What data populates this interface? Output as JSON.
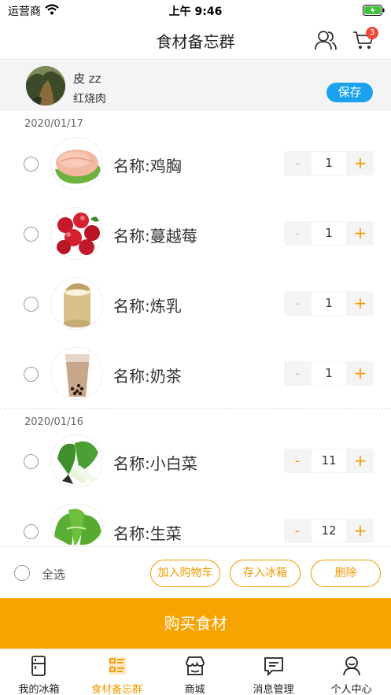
{
  "status_bar": {
    "carrier": "运营商",
    "time": "上午 9:46"
  },
  "nav": {
    "title": "食材备忘群",
    "cart_count": "3"
  },
  "user": {
    "name": "皮 zz",
    "dish": "红烧肉",
    "save_label": "保存"
  },
  "groups": [
    {
      "date": "2020/01/17",
      "items": [
        {
          "name": "名称:鸡胸",
          "qty": "1",
          "minus_enabled": false,
          "image": "chicken-breast"
        },
        {
          "name": "名称:蔓越莓",
          "qty": "1",
          "minus_enabled": false,
          "image": "cranberry"
        },
        {
          "name": "名称:炼乳",
          "qty": "1",
          "minus_enabled": false,
          "image": "condensed-milk-can"
        },
        {
          "name": "名称:奶茶",
          "qty": "1",
          "minus_enabled": false,
          "image": "bubble-tea"
        }
      ]
    },
    {
      "date": "2020/01/16",
      "items": [
        {
          "name": "名称:小白菜",
          "qty": "11",
          "minus_enabled": true,
          "image": "bok-choy"
        },
        {
          "name": "名称:生菜",
          "qty": "12",
          "minus_enabled": true,
          "image": "lettuce"
        }
      ]
    }
  ],
  "stepper": {
    "minus": "-",
    "plus": "+"
  },
  "actions": {
    "select_all": "全选",
    "add_to_cart": "加入购物车",
    "store_fridge": "存入冰箱",
    "delete": "删除",
    "buy": "购买食材"
  },
  "tabs": [
    {
      "label": "我的冰箱",
      "icon": "fridge-icon",
      "active": false
    },
    {
      "label": "食材备忘群",
      "icon": "memo-list-icon",
      "active": true
    },
    {
      "label": "商城",
      "icon": "store-icon",
      "active": false
    },
    {
      "label": "消息管理",
      "icon": "message-icon",
      "active": false
    },
    {
      "label": "个人中心",
      "icon": "person-icon",
      "active": false
    }
  ],
  "colors": {
    "accent": "#f29a00",
    "buy_bar": "#f7a300",
    "save_button": "#1aa2ef",
    "badge": "#f04a3c"
  }
}
